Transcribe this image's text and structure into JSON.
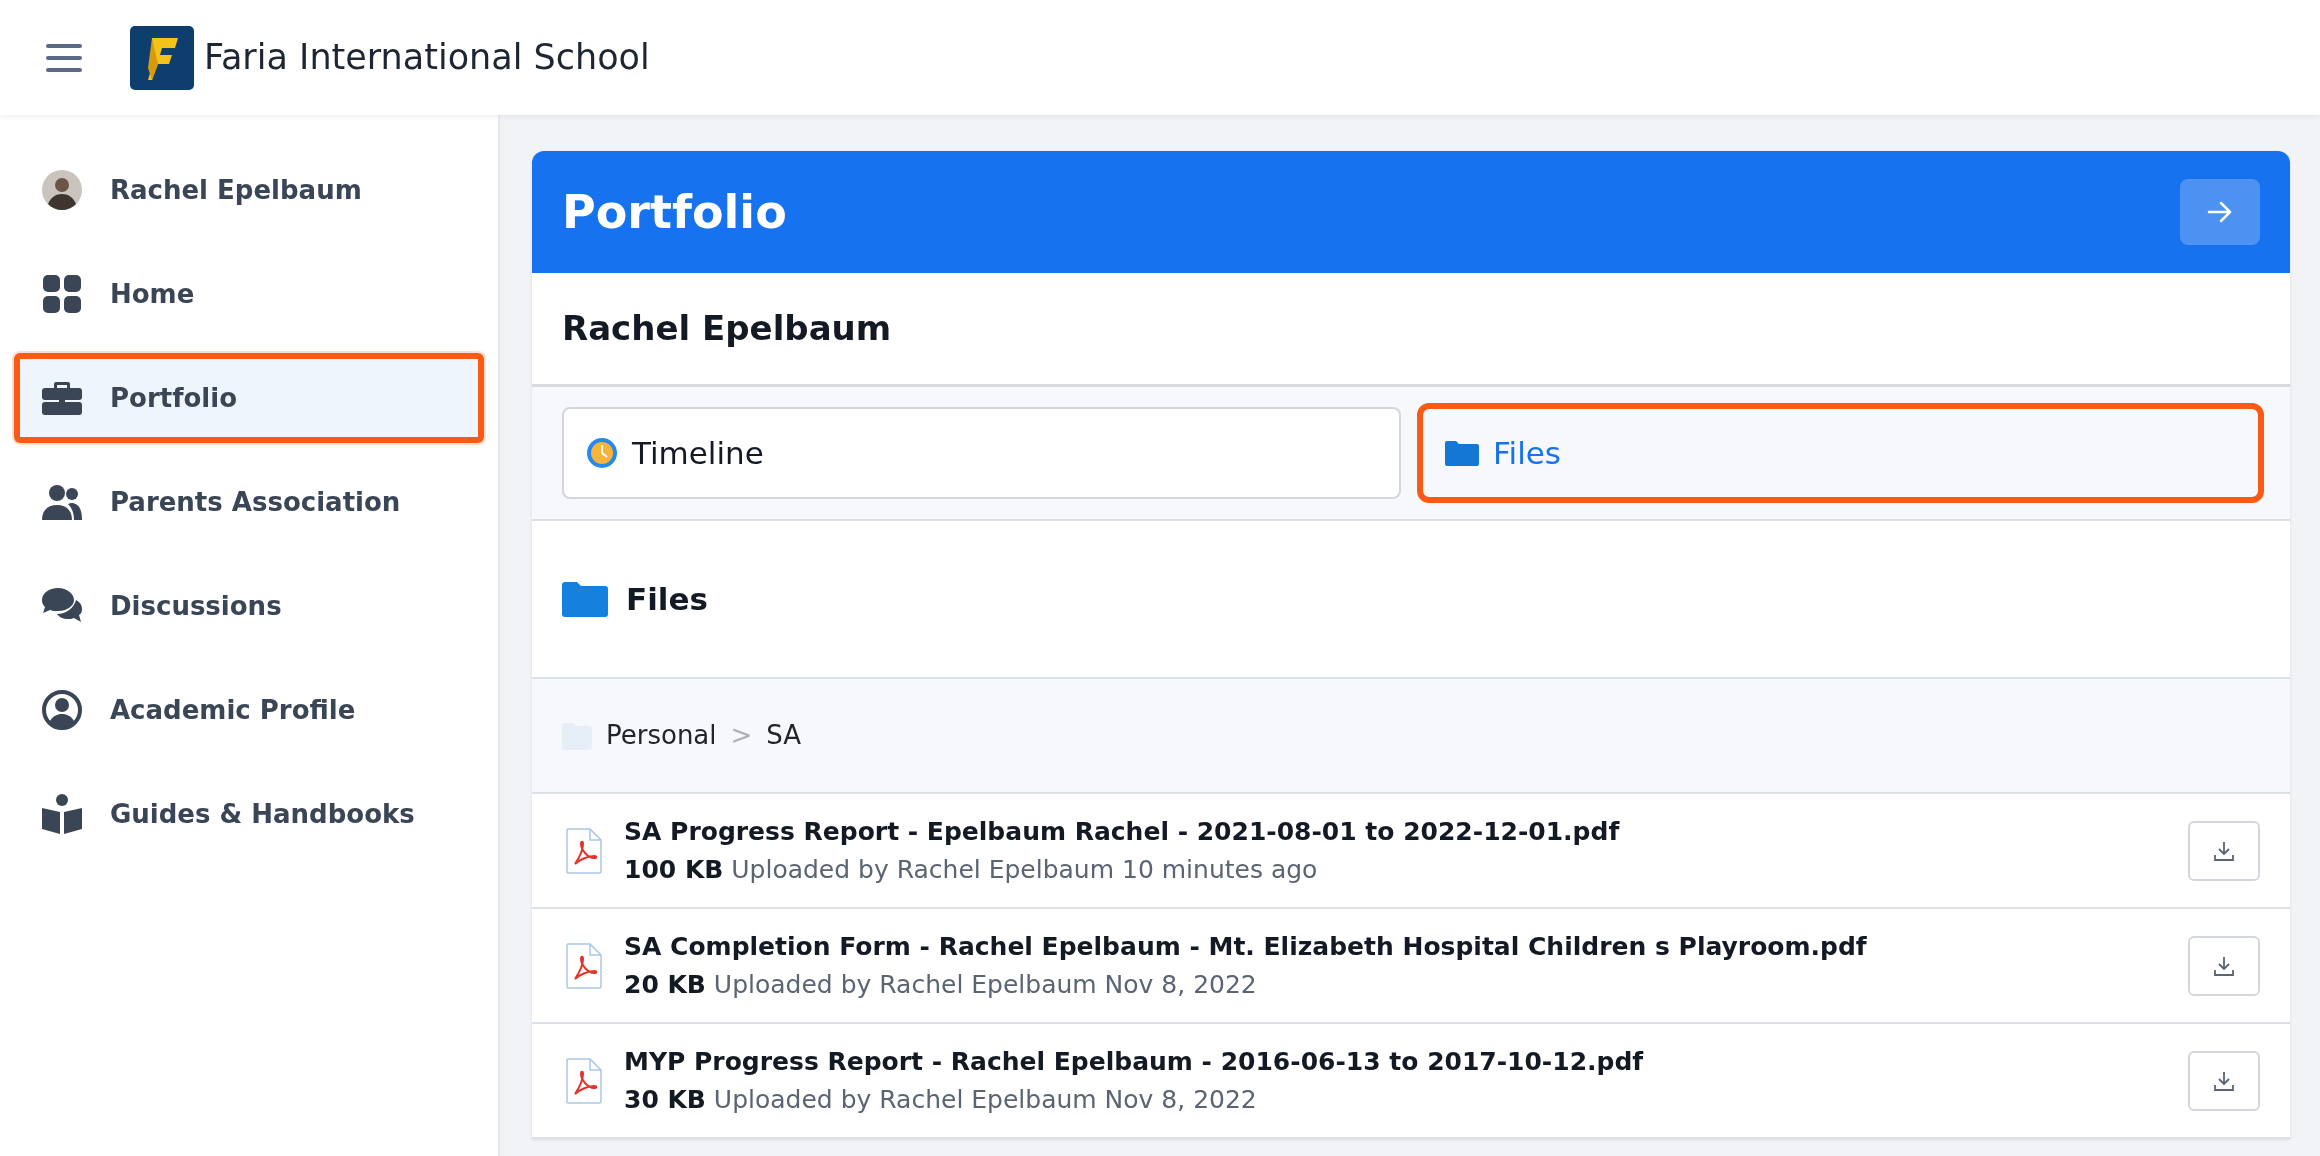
{
  "topbar": {
    "title": "Faria International School"
  },
  "sidebar": {
    "user": "Rachel Epelbaum",
    "items": [
      {
        "kind": "home",
        "label": "Home",
        "selected": false
      },
      {
        "kind": "portfolio",
        "label": "Portfolio",
        "selected": true
      },
      {
        "kind": "parents",
        "label": "Parents Association",
        "selected": false
      },
      {
        "kind": "discussions",
        "label": "Discussions",
        "selected": false
      },
      {
        "kind": "profile",
        "label": "Academic Profile",
        "selected": false
      },
      {
        "kind": "guides",
        "label": "Guides & Handbooks",
        "selected": false
      }
    ]
  },
  "panel": {
    "title": "Portfolio",
    "student": "Rachel Epelbaum",
    "tabs": [
      {
        "kind": "timeline",
        "label": "Timeline",
        "selected": false
      },
      {
        "kind": "files",
        "label": "Files",
        "selected": true
      }
    ],
    "section_title": "Files",
    "breadcrumb": [
      "Personal",
      "SA"
    ],
    "breadcrumb_separator": ">",
    "files": [
      {
        "name": "SA Progress Report - Epelbaum Rachel - 2021-08-01 to 2022-12-01.pdf",
        "size": "100 KB",
        "info": "Uploaded by Rachel Epelbaum 10 minutes ago"
      },
      {
        "name": "SA Completion Form - Rachel Epelbaum - Mt. Elizabeth Hospital Children s Playroom.pdf",
        "size": "20 KB",
        "info": "Uploaded by Rachel Epelbaum Nov 8, 2022"
      },
      {
        "name": "MYP Progress Report - Rachel Epelbaum - 2016-06-13 to 2017-10-12.pdf",
        "size": "30 KB",
        "info": "Uploaded by Rachel Epelbaum Nov 8, 2022"
      }
    ]
  }
}
